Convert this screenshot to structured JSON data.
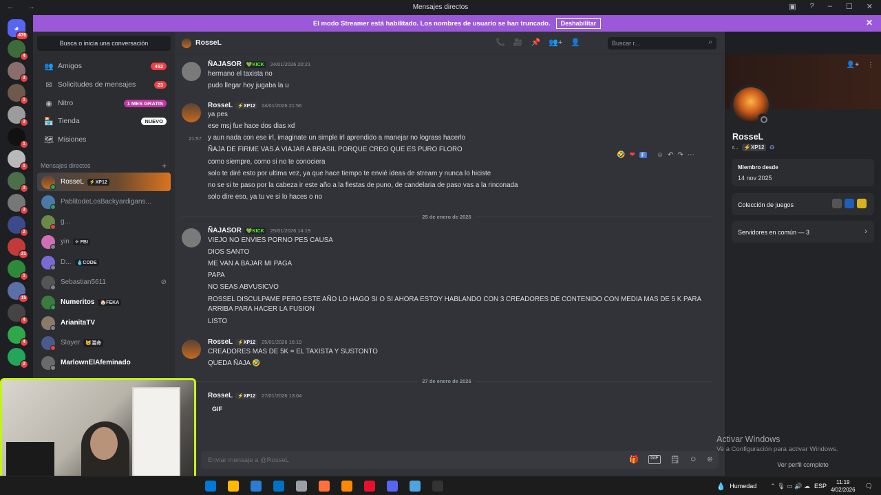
{
  "window": {
    "title": "Mensajes directos",
    "nav_arrows": "← →",
    "controls": [
      "▣",
      "?",
      "–",
      "☐",
      "✕"
    ]
  },
  "streamer_banner": {
    "text": "El modo Streamer está habilitado. Los nombres de usuario se han truncado.",
    "button": "Deshabilitar",
    "close": "✕"
  },
  "servers": {
    "home_badge": "476",
    "badges": [
      "4",
      "3",
      "1",
      "3",
      "1",
      "1",
      "3",
      "3",
      "2",
      "21",
      "1",
      "15",
      "4",
      "4",
      "2"
    ]
  },
  "sidebar": {
    "search_button": "Busca o inicia una conversación",
    "nav": [
      {
        "label": "Amigos",
        "icon": "👥",
        "pill": "452"
      },
      {
        "label": "Solicitudes de mensajes",
        "icon": "✉",
        "pill": "23"
      },
      {
        "label": "Nitro",
        "icon": "◉",
        "pill": "1 MES GRATIS"
      },
      {
        "label": "Tienda",
        "icon": "🏪",
        "pill": "NUEVO"
      },
      {
        "label": "Misiones",
        "icon": "🗺",
        "pill": ""
      }
    ],
    "dm_header": "Mensajes directos",
    "dm_add": "+",
    "dms": [
      {
        "name": "RosseL",
        "tag": "⚡XP12"
      },
      {
        "name": "PablitodeLosBackyardigans...",
        "tag": ""
      },
      {
        "name": "g...",
        "tag": ""
      },
      {
        "name": "yin",
        "tag": "✧ FBI"
      },
      {
        "name": "D...",
        "tag": "💧CODE"
      },
      {
        "name": "Sebastian5611",
        "tag": ""
      },
      {
        "name": "Numeritos",
        "tag": "🏠FEKA"
      },
      {
        "name": "ArianitaTV",
        "tag": ""
      },
      {
        "name": "Slayer",
        "tag": "🐱混命"
      },
      {
        "name": "MarlownElAfeminado",
        "tag": ""
      }
    ]
  },
  "channel": {
    "name": "RosseL",
    "search_placeholder": "Buscar r...",
    "tool_icons": [
      "📞",
      "🎥",
      "📌",
      "👥+",
      "👤"
    ]
  },
  "messages": [
    {
      "user": "ÑAJASOR",
      "badge": "💚KICK",
      "timestamp": "24/01/2026 20:21",
      "lines": [
        "hermano el taxista no",
        "pudo llegar hoy jugaba la u"
      ]
    },
    {
      "user": "RosseL",
      "badge": "⚡XP12",
      "timestamp": "24/01/2026 21:56",
      "lines": [
        "ya pes",
        "ese msj fue hace dos dias xd",
        "y aun nada con ese irl, imaginate un simple irl aprendido a manejar no lograss hacerlo",
        "ÑAJA DE FIRME VAS A VIAJAR A BRASIL PORQUE CREO QUE ES PURO FLORO",
        "como siempre, como si no te conociera",
        "solo te diré esto por ultima vez, ya que hace tiempo te envié ideas de stream y nunca lo hiciste",
        "no se si te paso por la cabeza ir este año a la fiestas de puno, de candelaria de paso vas a la rinconada",
        "solo dire eso, ya tu ve si lo haces o no"
      ],
      "hover_time": "21:57"
    },
    {
      "user": "ÑAJASOR",
      "badge": "💚KICK",
      "timestamp": "25/01/2026 14:19",
      "lines": [
        "VIEJO NO ENVIES PORNO PES CAUSA",
        "DIOS SANTO",
        "ME VAN A BAJAR MI PAGA",
        "PAPA",
        "NO SEAS ABVUSICVO",
        "ROSSEL DISCULPAME PERO ESTE AÑO LO HAGO SI O SI AHORA ESTOY HABLANDO CON 3 CREADORES DE CONTENIDO CON MEDIA MAS DE 5 K PARA",
        "ARRIBA PARA HACER LA FUSION",
        "LISTO"
      ]
    },
    {
      "user": "RosseL",
      "badge": "⚡XP12",
      "timestamp": "25/01/2026 16:19",
      "lines": [
        "CREADORES MAS DE 5K = EL TAXISTA Y SUSTONTO",
        "QUEDA ÑAJA 🤣"
      ]
    },
    {
      "user": "RosseL",
      "badge": "⚡XP12",
      "timestamp": "27/01/2026 13:04",
      "lines": [],
      "gif": "GIF"
    }
  ],
  "date_dividers": [
    "25 de enero de 2026",
    "27 de enero de 2026"
  ],
  "reactions": [
    "🤣",
    "❤",
    "F",
    "☺",
    "↶",
    "↷",
    "⋯"
  ],
  "composer": {
    "placeholder": "Enviar mensaje a @RosseL",
    "icons": [
      "🎁",
      "GIF",
      "🗒",
      "☺",
      "⁜"
    ]
  },
  "watermark": {
    "title": "Activar Windows",
    "subtitle": "Ve a Configuración para activar Windows."
  },
  "profile": {
    "name": "RosseL",
    "sub_prefix": "r...",
    "sub_tag": "⚡XP12",
    "member_since_label": "Miembro desde",
    "member_since": "14 nov 2025",
    "games_label": "Colección de juegos",
    "mutual_label": "Servidores en común — 3",
    "view_full": "Ver perfil completo",
    "top_icons": [
      "👤+",
      "⋮"
    ]
  },
  "taskbar": {
    "weather": "Humedad",
    "lang": "ESP",
    "time": "11:19",
    "date": "4/02/2026",
    "icons_color": [
      "#0078d4",
      "#ffb900",
      "#2b7cd3",
      "#0072c6",
      "#9aa0a6",
      "#ff7139",
      "#ff8800",
      "#e8112d",
      "#5865f2",
      "#4fa3e0",
      "#333333"
    ]
  },
  "colors": {
    "accent": "#5865f2",
    "banner": "#9b59d9",
    "mention_red": "#f23f43",
    "online": "#23a55a",
    "webcam_frame": "#c6f21b"
  }
}
